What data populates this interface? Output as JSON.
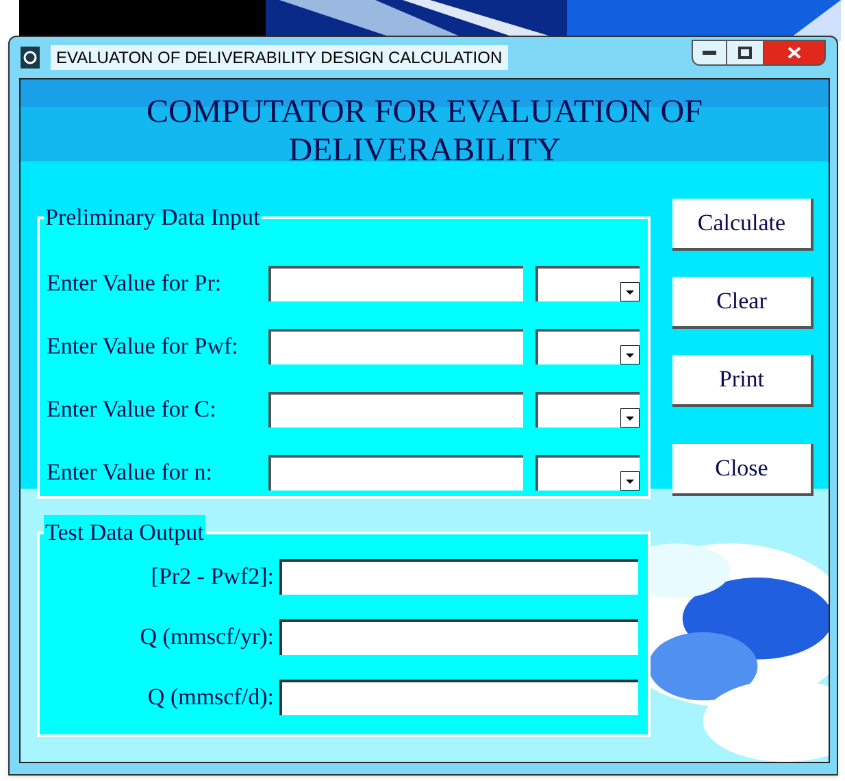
{
  "window": {
    "title": "EVALUATON OF DELIVERABILITY DESIGN CALCULATION"
  },
  "heading": "COMPUTATOR FOR EVALUATION OF DELIVERABILITY",
  "input_group": {
    "title": "Preliminary Data Input",
    "rows": [
      {
        "label": "Enter Value for Pr:"
      },
      {
        "label": "Enter Value for Pwf:"
      },
      {
        "label": "Enter Value for C:"
      },
      {
        "label": "Enter Value for n:"
      }
    ]
  },
  "buttons": [
    "Calculate",
    "Clear",
    "Print",
    "Close"
  ],
  "output_group": {
    "title": "Test Data Output",
    "rows": [
      {
        "label": "[Pr2 - Pwf2]:"
      },
      {
        "label": "Q (mmscf/yr):"
      },
      {
        "label": "Q (mmscf/d):"
      }
    ]
  }
}
